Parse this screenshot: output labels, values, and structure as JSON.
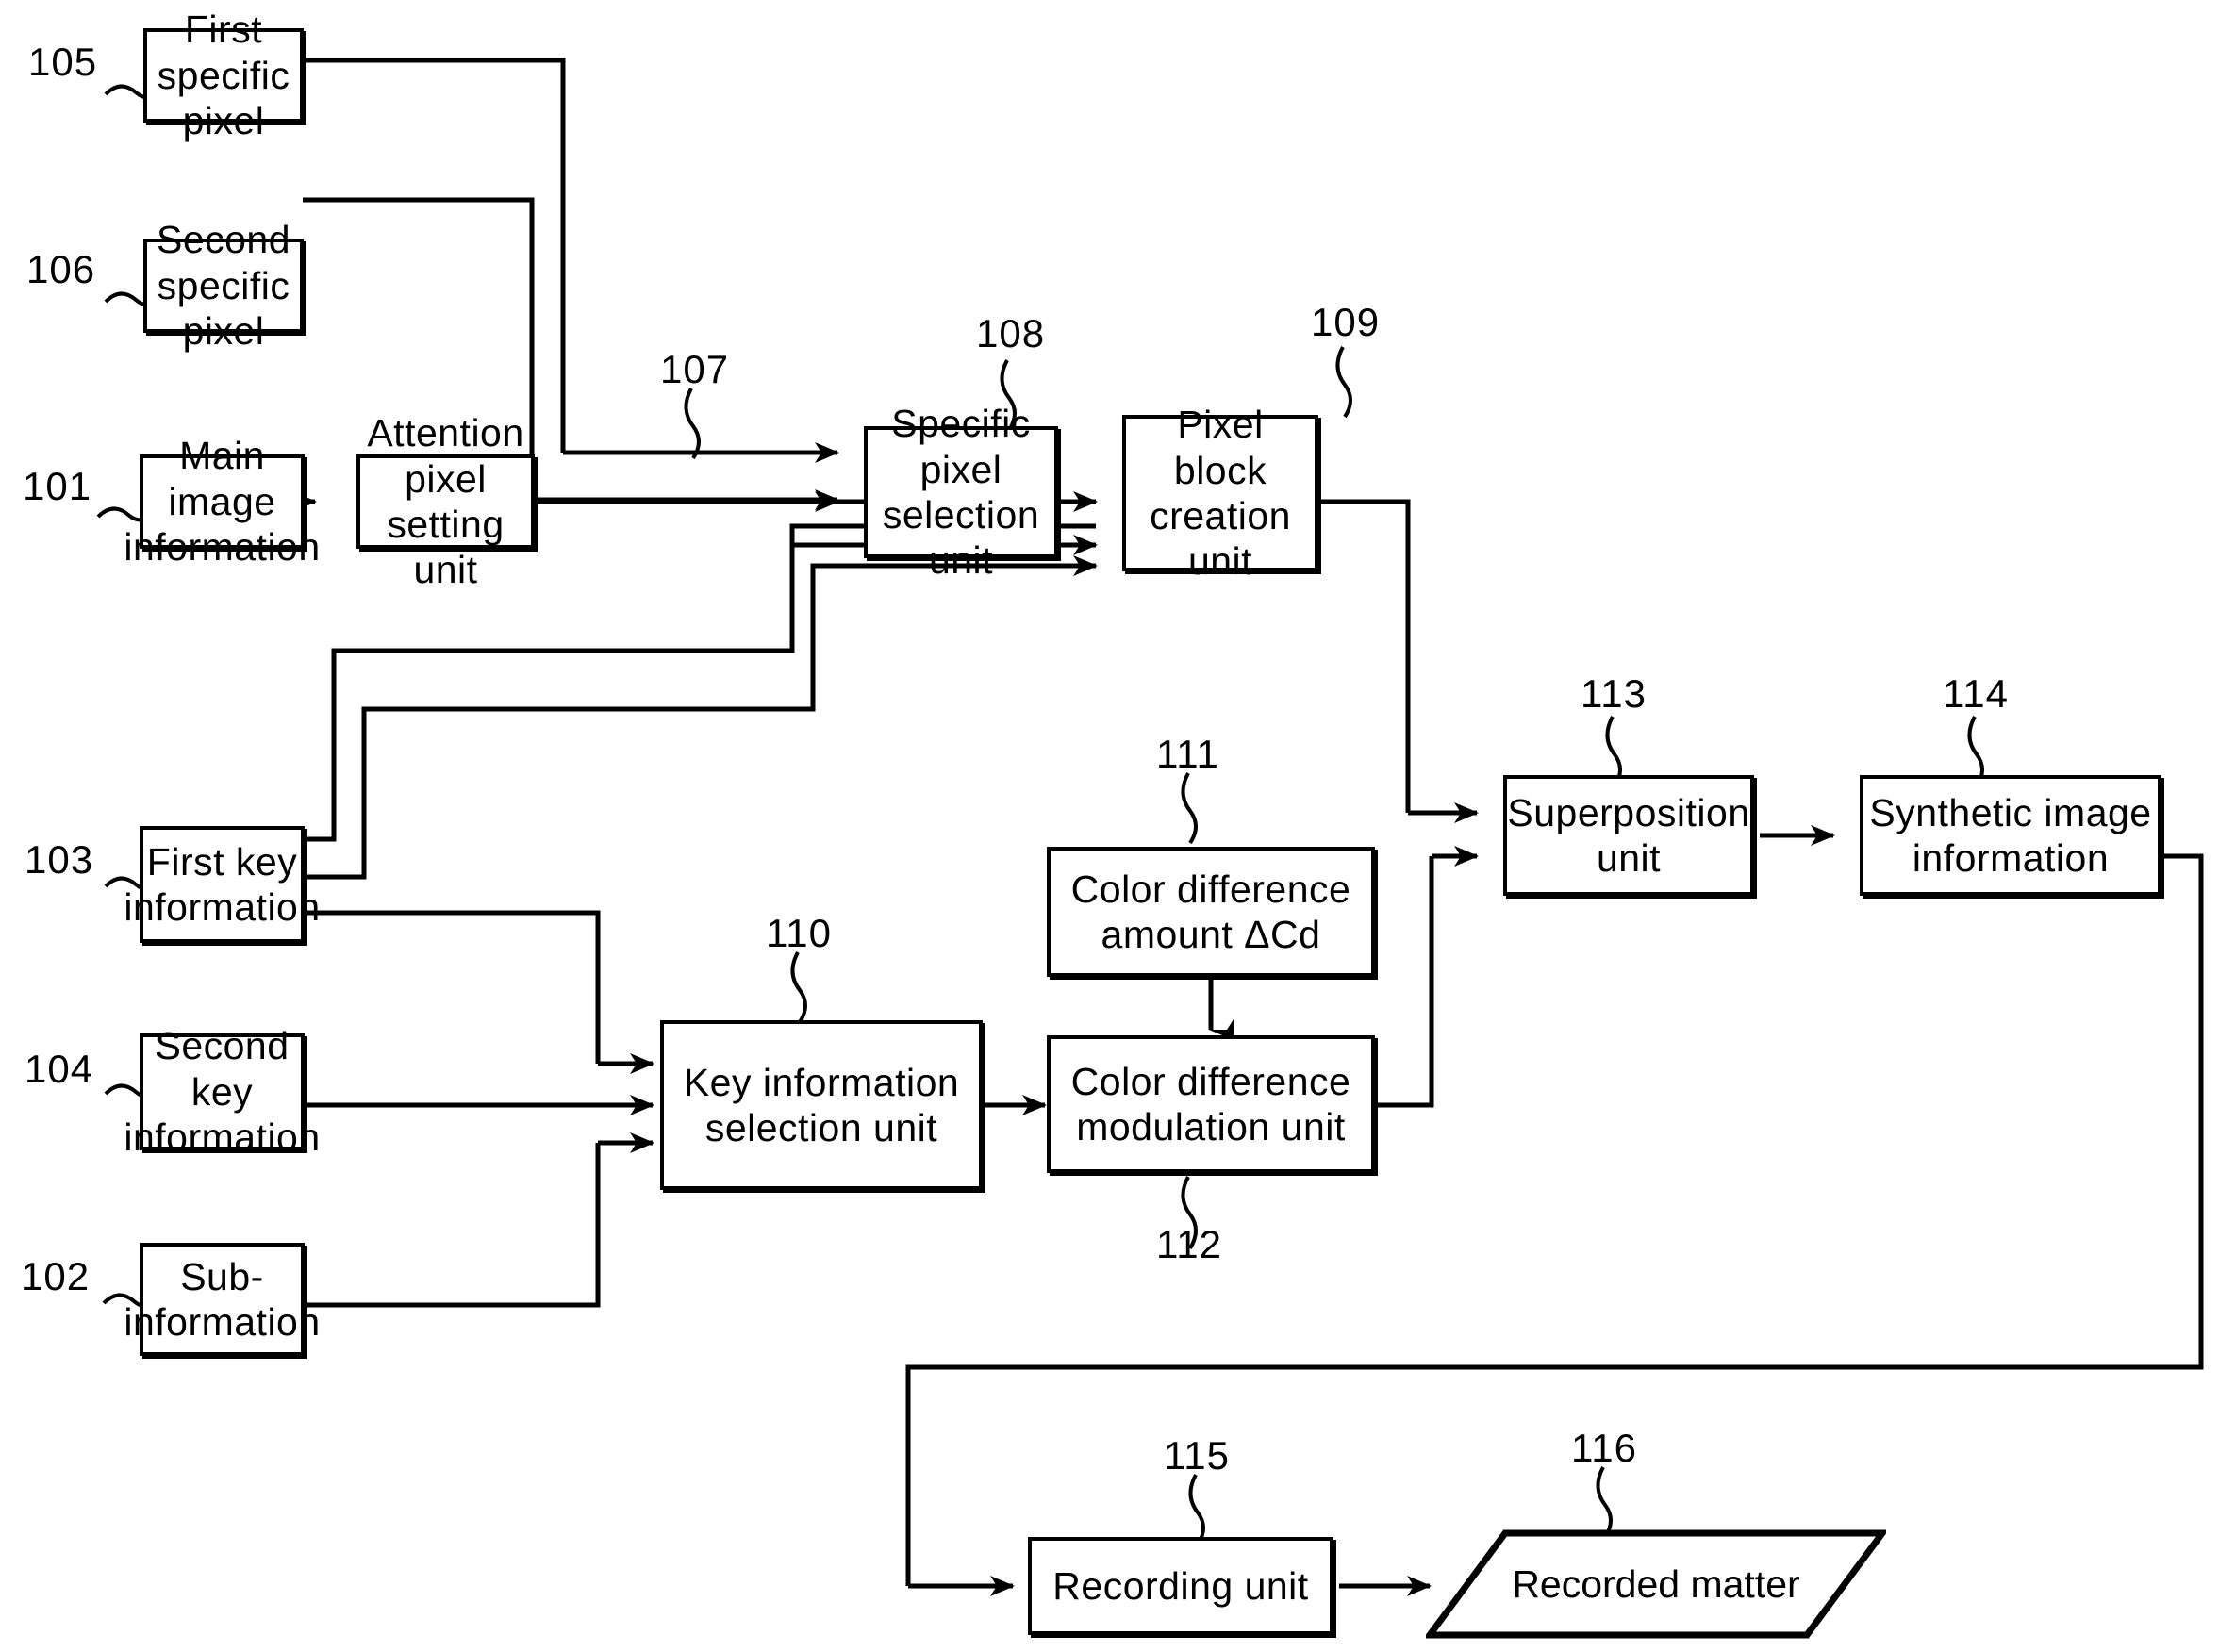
{
  "figure": {
    "type": "patent-block-diagram",
    "background": "#ffffff",
    "line_color": "#000000"
  },
  "blocks": [
    {
      "id": "105",
      "ref": "105",
      "label": "First specific\npixel",
      "shape": "rect"
    },
    {
      "id": "106",
      "ref": "106",
      "label": "Second specific\npixel",
      "shape": "rect"
    },
    {
      "id": "101",
      "ref": "101",
      "label": "Main image\ninformation",
      "shape": "rect"
    },
    {
      "id": "107",
      "ref": "107",
      "label": "Attention pixel\nsetting unit",
      "shape": "rect"
    },
    {
      "id": "108",
      "ref": "108",
      "label": "Specific pixel\nselection unit",
      "shape": "rect"
    },
    {
      "id": "109",
      "ref": "109",
      "label": "Pixel block\ncreation unit",
      "shape": "rect"
    },
    {
      "id": "113",
      "ref": "113",
      "label": "Superposition\nunit",
      "shape": "rect"
    },
    {
      "id": "114",
      "ref": "114",
      "label": "Synthetic image\ninformation",
      "shape": "rect"
    },
    {
      "id": "103",
      "ref": "103",
      "label": "First key\ninformation",
      "shape": "rect"
    },
    {
      "id": "104",
      "ref": "104",
      "label": "Second key\ninformation",
      "shape": "rect"
    },
    {
      "id": "102",
      "ref": "102",
      "label": "Sub-information",
      "shape": "rect"
    },
    {
      "id": "110",
      "ref": "110",
      "label": "Key information\nselection unit",
      "shape": "rect"
    },
    {
      "id": "111",
      "ref": "111",
      "label": "Color difference\namount  ΔCd",
      "shape": "rect"
    },
    {
      "id": "112",
      "ref": "112",
      "label": "Color difference\nmodulation unit",
      "shape": "rect"
    },
    {
      "id": "115",
      "ref": "115",
      "label": "Recording unit",
      "shape": "rect"
    },
    {
      "id": "116",
      "ref": "116",
      "label": "Recorded matter",
      "shape": "parallelogram"
    }
  ],
  "reference_numerals": {
    "n101": "101",
    "n102": "102",
    "n103": "103",
    "n104": "104",
    "n105": "105",
    "n106": "106",
    "n107": "107",
    "n108": "108",
    "n109": "109",
    "n110": "110",
    "n111": "111",
    "n112": "112",
    "n113": "113",
    "n114": "114",
    "n115": "115",
    "n116": "116"
  },
  "labels": {
    "b105": "First specific\npixel",
    "b106": "Second specific\npixel",
    "b101": "Main image\ninformation",
    "b107": "Attention pixel\nsetting unit",
    "b108": "Specific pixel\nselection unit",
    "b109": "Pixel block\ncreation unit",
    "b113": "Superposition\nunit",
    "b114": "Synthetic image\ninformation",
    "b103": "First key\ninformation",
    "b104": "Second key\ninformation",
    "b102": "Sub-information",
    "b110": "Key information\nselection unit",
    "b111": "Color difference\namount  ΔCd",
    "b112": "Color difference\nmodulation unit",
    "b115": "Recording unit",
    "b116": "Recorded matter"
  },
  "connections": [
    {
      "from": "105",
      "to": "108"
    },
    {
      "from": "106",
      "to": "108"
    },
    {
      "from": "101",
      "to": "107"
    },
    {
      "from": "107",
      "to": "108"
    },
    {
      "from": "108",
      "to": "109"
    },
    {
      "from": "103",
      "to": "108"
    },
    {
      "from": "103",
      "to": "109"
    },
    {
      "from": "103",
      "to": "110"
    },
    {
      "from": "104",
      "to": "110"
    },
    {
      "from": "102",
      "to": "110"
    },
    {
      "from": "110",
      "to": "112"
    },
    {
      "from": "111",
      "to": "112"
    },
    {
      "from": "112",
      "to": "113"
    },
    {
      "from": "109",
      "to": "113"
    },
    {
      "from": "113",
      "to": "114"
    },
    {
      "from": "114",
      "to": "115"
    },
    {
      "from": "115",
      "to": "116"
    }
  ]
}
